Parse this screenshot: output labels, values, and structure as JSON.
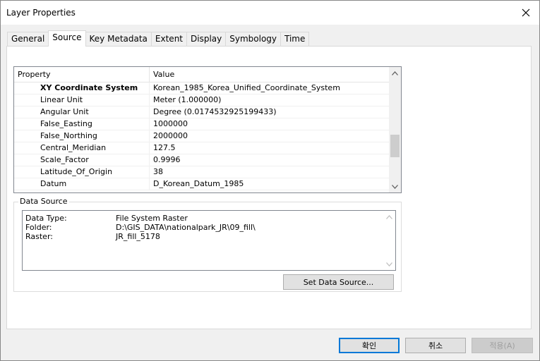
{
  "window": {
    "title": "Layer Properties"
  },
  "tabs": [
    "General",
    "Source",
    "Key Metadata",
    "Extent",
    "Display",
    "Symbology",
    "Time"
  ],
  "active_tab": "Source",
  "grid": {
    "headers": {
      "property": "Property",
      "value": "Value"
    },
    "rows": [
      {
        "property": "XY Coordinate System",
        "value": "Korean_1985_Korea_Unified_Coordinate_System",
        "bold": true
      },
      {
        "property": "Linear Unit",
        "value": "Meter (1.000000)"
      },
      {
        "property": "Angular Unit",
        "value": "Degree (0.0174532925199433)"
      },
      {
        "property": "False_Easting",
        "value": "1000000"
      },
      {
        "property": "False_Northing",
        "value": "2000000"
      },
      {
        "property": "Central_Meridian",
        "value": "127.5"
      },
      {
        "property": "Scale_Factor",
        "value": "0.9996"
      },
      {
        "property": "Latitude_Of_Origin",
        "value": "38"
      },
      {
        "property": "Datum",
        "value": "D_Korean_Datum_1985"
      }
    ]
  },
  "data_source": {
    "legend": "Data Source",
    "rows": [
      {
        "label": "Data Type:",
        "value": "File System Raster"
      },
      {
        "label": "Folder:",
        "value": "D:\\GIS_DATA\\nationalpark_JR\\09_fill\\"
      },
      {
        "label": "Raster:",
        "value": "JR_fill_5178"
      }
    ],
    "set_button": "Set Data Source..."
  },
  "footer": {
    "ok": "확인",
    "cancel": "취소",
    "apply": "적용(A)"
  },
  "icons": {
    "close": "close-icon",
    "scroll_up": "chevron-up-icon",
    "scroll_down": "chevron-down-icon"
  }
}
